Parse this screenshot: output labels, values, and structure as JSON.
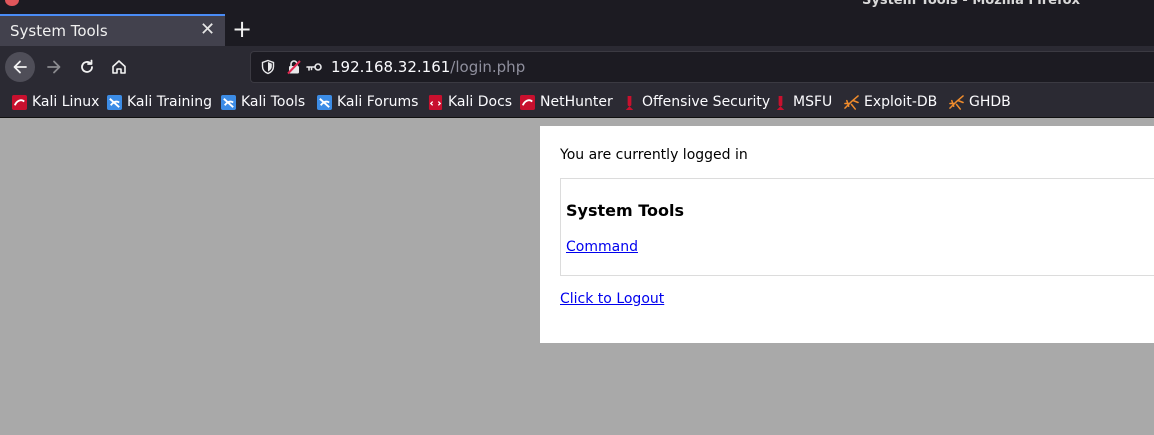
{
  "window": {
    "title": "System Tools - Mozilla Firefox"
  },
  "tabs": [
    {
      "title": "System Tools",
      "active": true
    }
  ],
  "new_tab_icon": "plus-icon",
  "nav": {
    "back_icon": "arrow-left-icon",
    "forward_icon": "arrow-right-icon",
    "reload_icon": "reload-icon",
    "home_icon": "home-icon"
  },
  "urlbar": {
    "host": "192.168.32.161",
    "path": "/login.php",
    "icons": [
      "shield-icon",
      "insecure-lock-icon",
      "key-icon"
    ]
  },
  "bookmarks": [
    {
      "label": "Kali Linux",
      "icon": "kali-dragon-icon"
    },
    {
      "label": "Kali Training",
      "icon": "kali-training-icon"
    },
    {
      "label": "Kali Tools",
      "icon": "kali-tools-icon"
    },
    {
      "label": "Kali Forums",
      "icon": "kali-forums-icon"
    },
    {
      "label": "Kali Docs",
      "icon": "kali-docs-icon"
    },
    {
      "label": "NetHunter",
      "icon": "nethunter-icon"
    },
    {
      "label": "Offensive Security",
      "icon": "offsec-icon"
    },
    {
      "label": "MSFU",
      "icon": "msfu-icon"
    },
    {
      "label": "Exploit-DB",
      "icon": "exploit-db-icon"
    },
    {
      "label": "GHDB",
      "icon": "ghdb-icon"
    }
  ],
  "page": {
    "status": "You are currently logged in",
    "section_title": "System Tools",
    "command_link": "Command",
    "logout_link": "Click to Logout"
  },
  "colors": {
    "page_background": "#a9a9a9",
    "link": "#0000ee",
    "chrome_dark": "#1c1b22",
    "toolbar": "#2b2a33",
    "tab_accent": "#4a8cf6"
  }
}
